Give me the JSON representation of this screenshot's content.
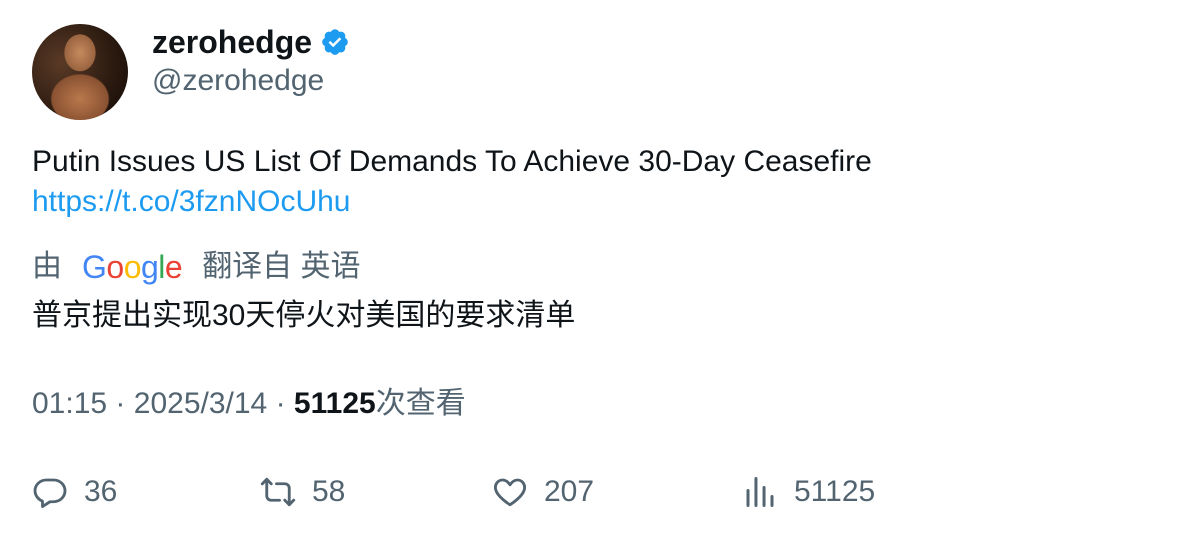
{
  "author": {
    "display_name": "zerohedge",
    "handle": "@zerohedge",
    "verified_color": "#1d9bf0"
  },
  "tweet": {
    "text": "Putin Issues US List Of Demands To Achieve 30-Day Ceasefire",
    "link": "https://t.co/3fznNOcUhu"
  },
  "translation": {
    "prefix": "由",
    "provider": "Google",
    "suffix": "翻译自 英语",
    "text": "普京提出实现30天停火对美国的要求清单"
  },
  "meta": {
    "time": "01:15",
    "separator": "·",
    "date": "2025/3/14",
    "views_count": "51125",
    "views_label": "次查看"
  },
  "actions": {
    "reply_count": "36",
    "retweet_count": "58",
    "like_count": "207",
    "views_count": "51125"
  },
  "icons": {
    "reply": "reply-icon",
    "retweet": "retweet-icon",
    "like": "heart-icon",
    "views": "analytics-icon",
    "verified": "verified-badge-icon"
  }
}
